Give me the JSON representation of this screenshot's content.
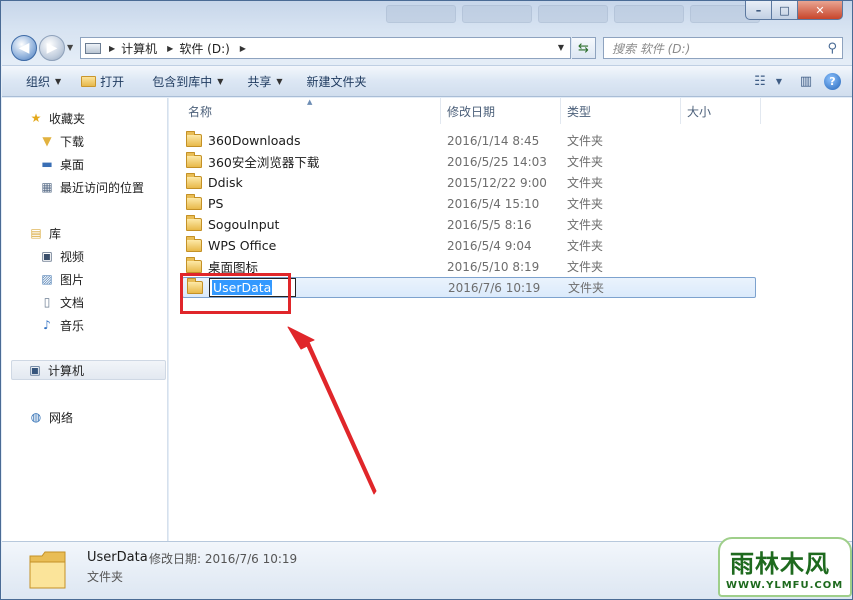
{
  "window": {
    "controls": {
      "min": "–",
      "max": "□",
      "close": "✕"
    }
  },
  "address": {
    "crumbs": [
      "计算机",
      "软件 (D:)"
    ]
  },
  "search": {
    "placeholder": "搜索 软件 (D:)"
  },
  "toolbar": {
    "organize": "组织",
    "open": "打开",
    "include_library": "包含到库中",
    "share": "共享",
    "new_folder": "新建文件夹"
  },
  "nav": {
    "favorites": {
      "label": "收藏夹",
      "items": [
        "下载",
        "桌面",
        "最近访问的位置"
      ]
    },
    "libraries": {
      "label": "库",
      "items": [
        "视频",
        "图片",
        "文档",
        "音乐"
      ]
    },
    "computer": "计算机",
    "network": "网络"
  },
  "columns": {
    "name": "名称",
    "date": "修改日期",
    "type": "类型",
    "size": "大小"
  },
  "files": [
    {
      "name": "360Downloads",
      "date": "2016/1/14 8:45",
      "type": "文件夹"
    },
    {
      "name": "360安全浏览器下载",
      "date": "2016/5/25 14:03",
      "type": "文件夹"
    },
    {
      "name": "Ddisk",
      "date": "2015/12/22 9:00",
      "type": "文件夹"
    },
    {
      "name": "PS",
      "date": "2016/5/4 15:10",
      "type": "文件夹"
    },
    {
      "name": "SogouInput",
      "date": "2016/5/5 8:16",
      "type": "文件夹"
    },
    {
      "name": "WPS Office",
      "date": "2016/5/4 9:04",
      "type": "文件夹"
    },
    {
      "name": "桌面图标",
      "date": "2016/5/10 8:19",
      "type": "文件夹"
    },
    {
      "name": "UserData",
      "date": "2016/7/6 10:19",
      "type": "文件夹",
      "selected": true,
      "renaming": true
    }
  ],
  "details": {
    "name": "UserData",
    "meta_label": "修改日期:",
    "meta_value": "2016/7/6 10:19",
    "type": "文件夹"
  },
  "watermark": {
    "main": "雨林木风",
    "url": "WWW.YLMFU.COM"
  },
  "colors": {
    "accent": "#3399ff",
    "annotation": "#e0262a",
    "selection_border": "#7da2ce"
  }
}
